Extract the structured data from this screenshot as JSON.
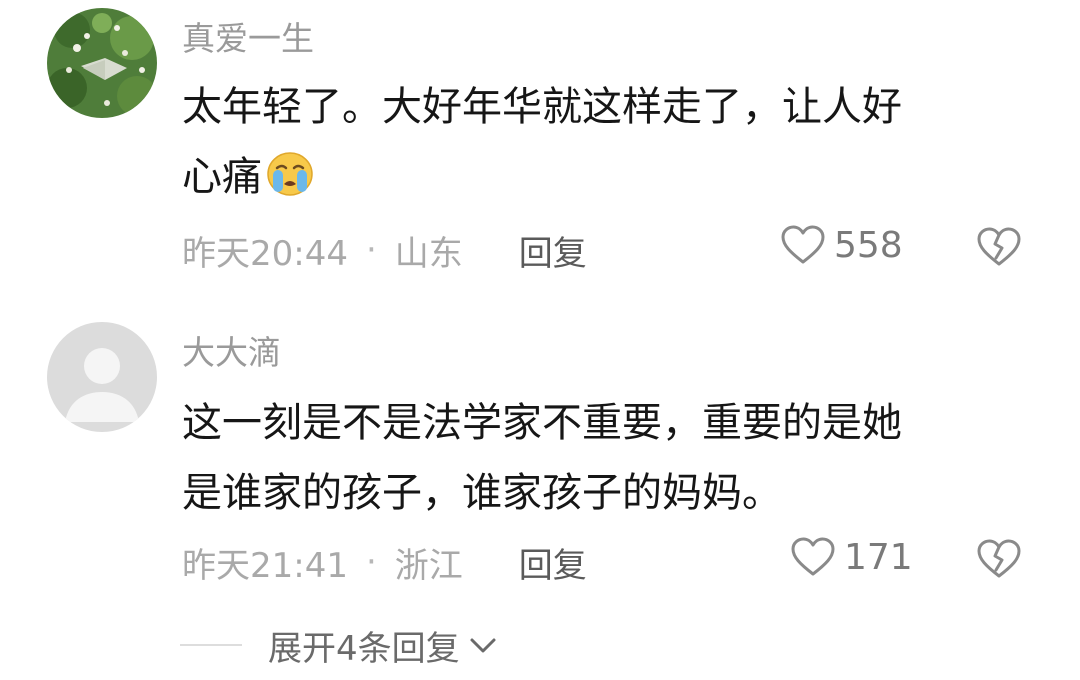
{
  "comments": [
    {
      "username": "真爱一生",
      "text": "太年轻了。大好年华就这样走了，让人好\n心痛",
      "emoji": "crying-face-icon",
      "time": "昨天20:44",
      "separator": "·",
      "region": "山东",
      "reply_label": "回复",
      "likes": "558"
    },
    {
      "username": "大大滴",
      "text": "这一刻是不是法学家不重要，重要的是她\n是谁家的孩子，谁家孩子的妈妈。",
      "time": "昨天21:41",
      "separator": "·",
      "region": "浙江",
      "reply_label": "回复",
      "likes": "171"
    }
  ],
  "expand_replies": {
    "label": "展开4条回复",
    "icon": "chevron-down-icon"
  },
  "colors": {
    "username": "#9a9a9a",
    "text": "#161616",
    "meta": "#a9a9a9",
    "icon": "#8a8a8a"
  }
}
